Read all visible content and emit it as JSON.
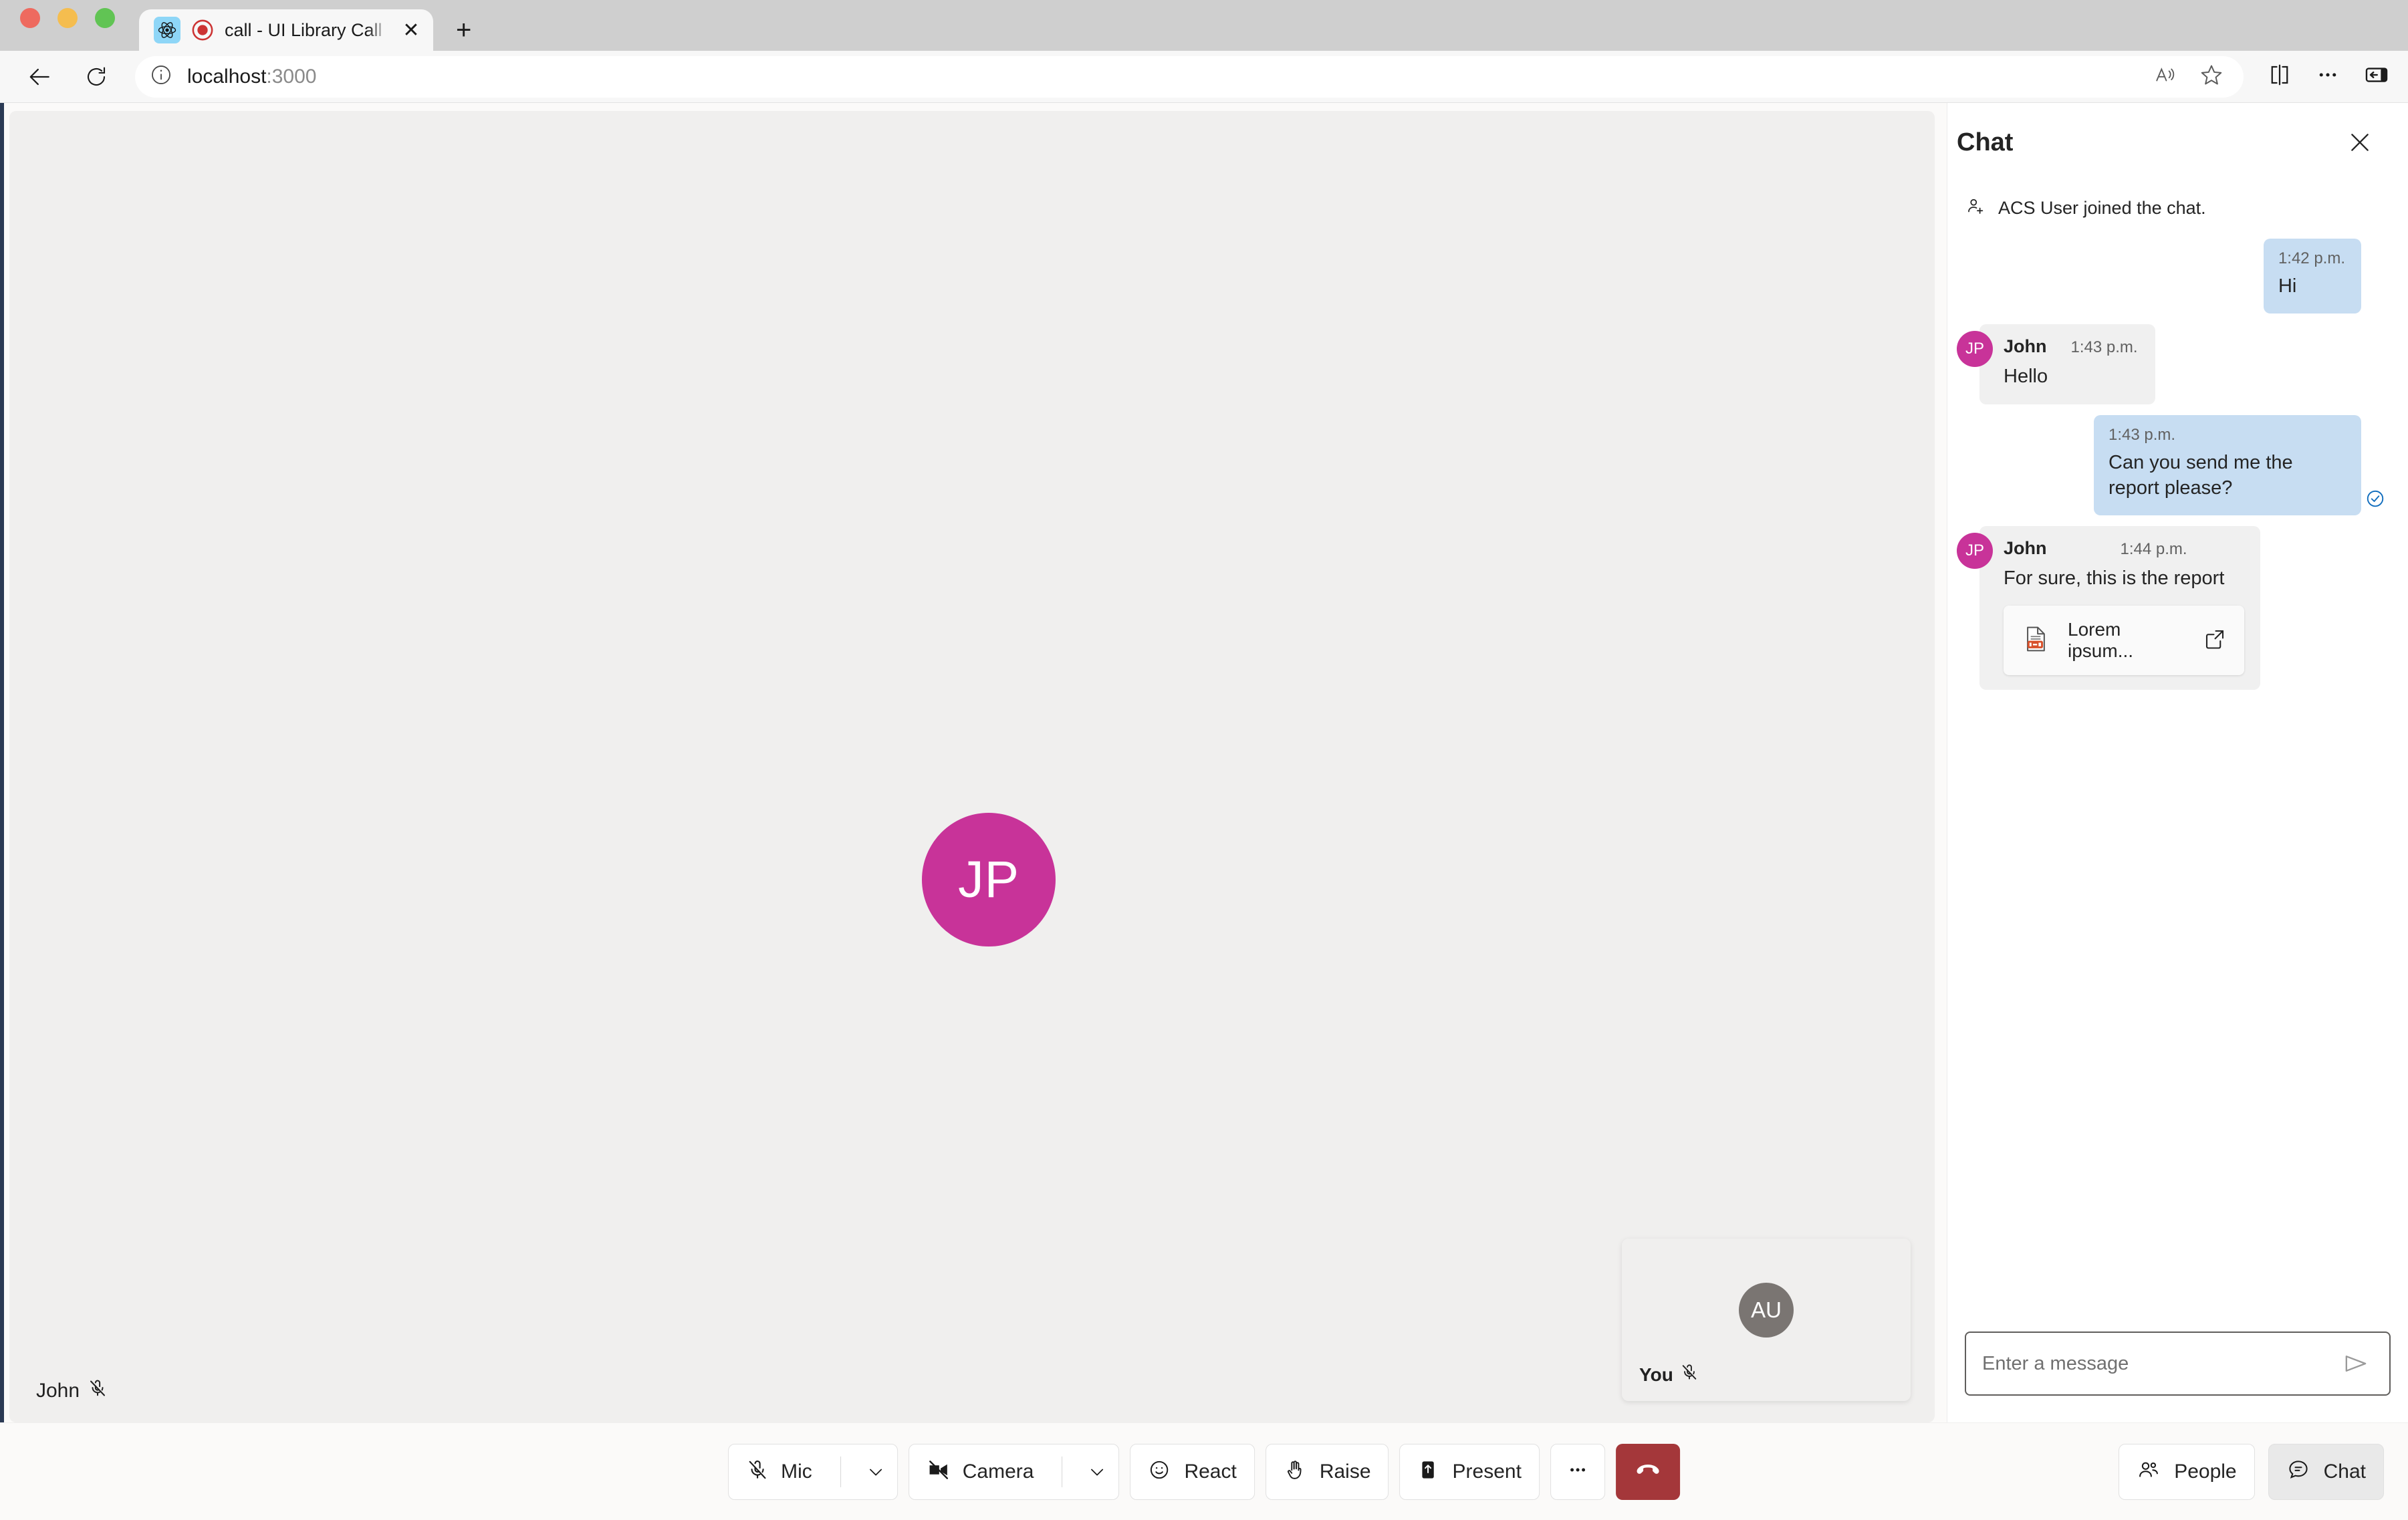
{
  "browser": {
    "tab": {
      "title": "call - UI Library Call With C",
      "favicon_name": "react-logo-icon",
      "recording_indicator": "recording-icon",
      "close_label": "✕"
    },
    "new_tab_label": "+",
    "back_icon": "back-arrow-icon",
    "reload_icon": "reload-icon",
    "omnibox": {
      "info_icon": "site-info-icon",
      "host": "localhost",
      "port": ":3000"
    },
    "toolbar_icons": [
      "read-aloud-icon",
      "favorite-star-icon",
      "split-screen-icon",
      "more-options-icon",
      "collections-icon"
    ]
  },
  "stage": {
    "remote_participant": {
      "initials": "JP",
      "name": "John",
      "muted": true,
      "avatar_color": "#C83399"
    },
    "local_participant": {
      "initials": "AU",
      "name": "You",
      "muted": true,
      "avatar_color": "#7A7572"
    }
  },
  "chat": {
    "title": "Chat",
    "close_label": "✕",
    "system_message": "ACS User joined the chat.",
    "messages": [
      {
        "side": "me",
        "time": "1:42 p.m.",
        "text": "Hi",
        "read": false
      },
      {
        "side": "them",
        "sender": "John",
        "initials": "JP",
        "time": "1:43 p.m.",
        "text": "Hello"
      },
      {
        "side": "me",
        "time": "1:43 p.m.",
        "text": "Can you send me the report please?",
        "read": true
      },
      {
        "side": "them",
        "sender": "John",
        "initials": "JP",
        "time": "1:44 p.m.",
        "text": "For sure, this is the report",
        "attachment": {
          "filename": "Lorem ipsum...",
          "file_icon": "document-file-icon",
          "open_icon": "open-external-icon"
        }
      }
    ],
    "compose": {
      "placeholder": "Enter a message",
      "value": "",
      "send_icon": "send-icon"
    }
  },
  "controls": {
    "mic": {
      "label": "Mic",
      "icon": "mic-off-icon",
      "has_menu": true,
      "menu_icon": "chevron-down-icon"
    },
    "camera": {
      "label": "Camera",
      "icon": "camera-off-icon",
      "has_menu": true,
      "menu_icon": "chevron-down-icon"
    },
    "react": {
      "label": "React",
      "icon": "emoji-react-icon"
    },
    "raise": {
      "label": "Raise",
      "icon": "raise-hand-icon"
    },
    "present": {
      "label": "Present",
      "icon": "share-screen-icon"
    },
    "more": {
      "label": "",
      "icon": "more-horizontal-icon"
    },
    "hangup": {
      "label": "",
      "icon": "end-call-icon",
      "color": "#A4373A"
    },
    "people": {
      "label": "People",
      "icon": "people-icon"
    },
    "chat": {
      "label": "Chat",
      "icon": "chat-bubble-icon",
      "active": true
    }
  }
}
